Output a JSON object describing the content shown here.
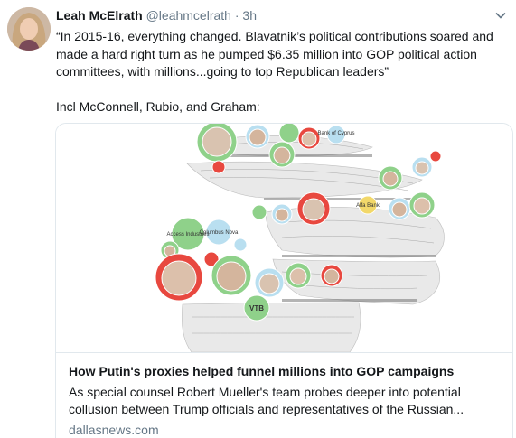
{
  "tweet": {
    "author_name": "Leah McElrath",
    "handle": "@leahmcelrath",
    "separator": "·",
    "time": "3h",
    "body": "“In 2015-16, everything changed. Blavatnik’s political contributions soared and made a hard right turn as he pumped $6.35 million into GOP political action committees, with millions...going to top Republican leaders”\n\nIncl McConnell, Rubio, and Graham:"
  },
  "card": {
    "title": "How Putin's proxies helped funnel millions into GOP campaigns",
    "description": "As special counsel Robert Mueller's team probes deeper into potential collusion between Trump officials and representatives of the Russian...",
    "domain": "dallasnews.com",
    "image_labels": {
      "bank": "Bank of Cyprus",
      "alfa": "Alfa Bank",
      "access": "Access Industries",
      "columbus": "Columbus Nova",
      "vtb": "VTB"
    }
  },
  "icons": {
    "caret": "chevron-down-icon"
  },
  "colors": {
    "text": "#14171a",
    "secondary": "#657786",
    "border": "#e1e8ed",
    "bubble_green": "#8fd18a",
    "bubble_red": "#e8483f",
    "bubble_blue": "#b9dff0",
    "bubble_yellow": "#f2d86a"
  }
}
